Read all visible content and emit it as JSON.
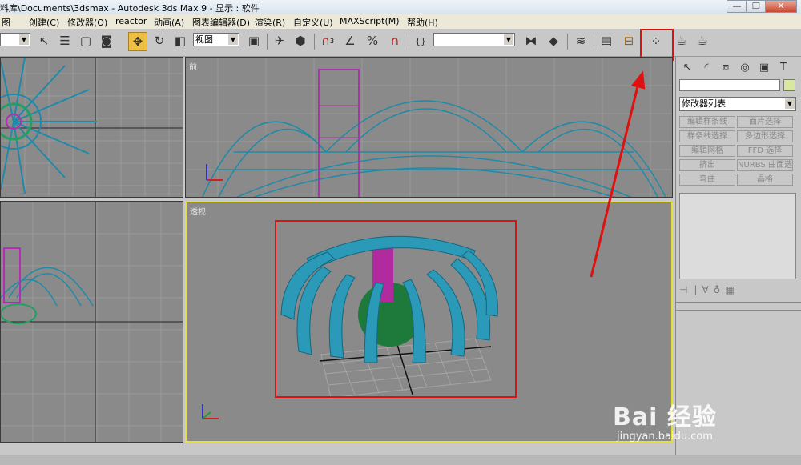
{
  "window": {
    "title": "料库\\Documents\\3dsmax    - Autodesk 3ds Max 9    - 显示 : 软件",
    "controls": {
      "minimize": "—",
      "restore": "❐",
      "close": "✕"
    }
  },
  "menu": {
    "items": [
      "图",
      "创建(C)",
      "修改器(O)",
      "reactor",
      "动画(A)",
      "图表编辑器(D)",
      "渲染(R)",
      "自定义(U)",
      "MAXScript(M)",
      "帮助(H)"
    ]
  },
  "toolbar": {
    "view_dropdown": "视图",
    "icons": [
      "select-arrow-icon",
      "select-by-name-icon",
      "rect-select-icon",
      "window-crossing-icon",
      "move-icon",
      "rotate-icon",
      "scale-icon",
      "mirror-tool-icon",
      "snap-icon",
      "angle-snap-icon",
      "percent-snap-icon",
      "spinner-snap-icon",
      "named-selection-icon",
      "mirror-icon",
      "align-icon",
      "layer-manager-icon",
      "curve-editor-icon",
      "schematic-view-icon",
      "material-editor-icon",
      "render-scene-icon",
      "quick-render-icon"
    ],
    "snap_label": "3",
    "highlight_color": "#e01010"
  },
  "viewports": {
    "top_left": {
      "label": ""
    },
    "front": {
      "label": "前"
    },
    "left": {
      "label": ""
    },
    "perspective": {
      "label": "透视",
      "border_color": "#e8e030"
    }
  },
  "command_panel": {
    "modifier_list": "修改器列表",
    "buttons": [
      "编辑样条线",
      "面片选择",
      "样条线选择",
      "多边形选择",
      "编辑网格",
      "FFD 选择",
      "挤出",
      "NURBS 曲面选择",
      "弯曲",
      "晶格"
    ]
  },
  "watermark": {
    "logo": "Bai 经验",
    "url": "jingyan.baidu.com"
  }
}
